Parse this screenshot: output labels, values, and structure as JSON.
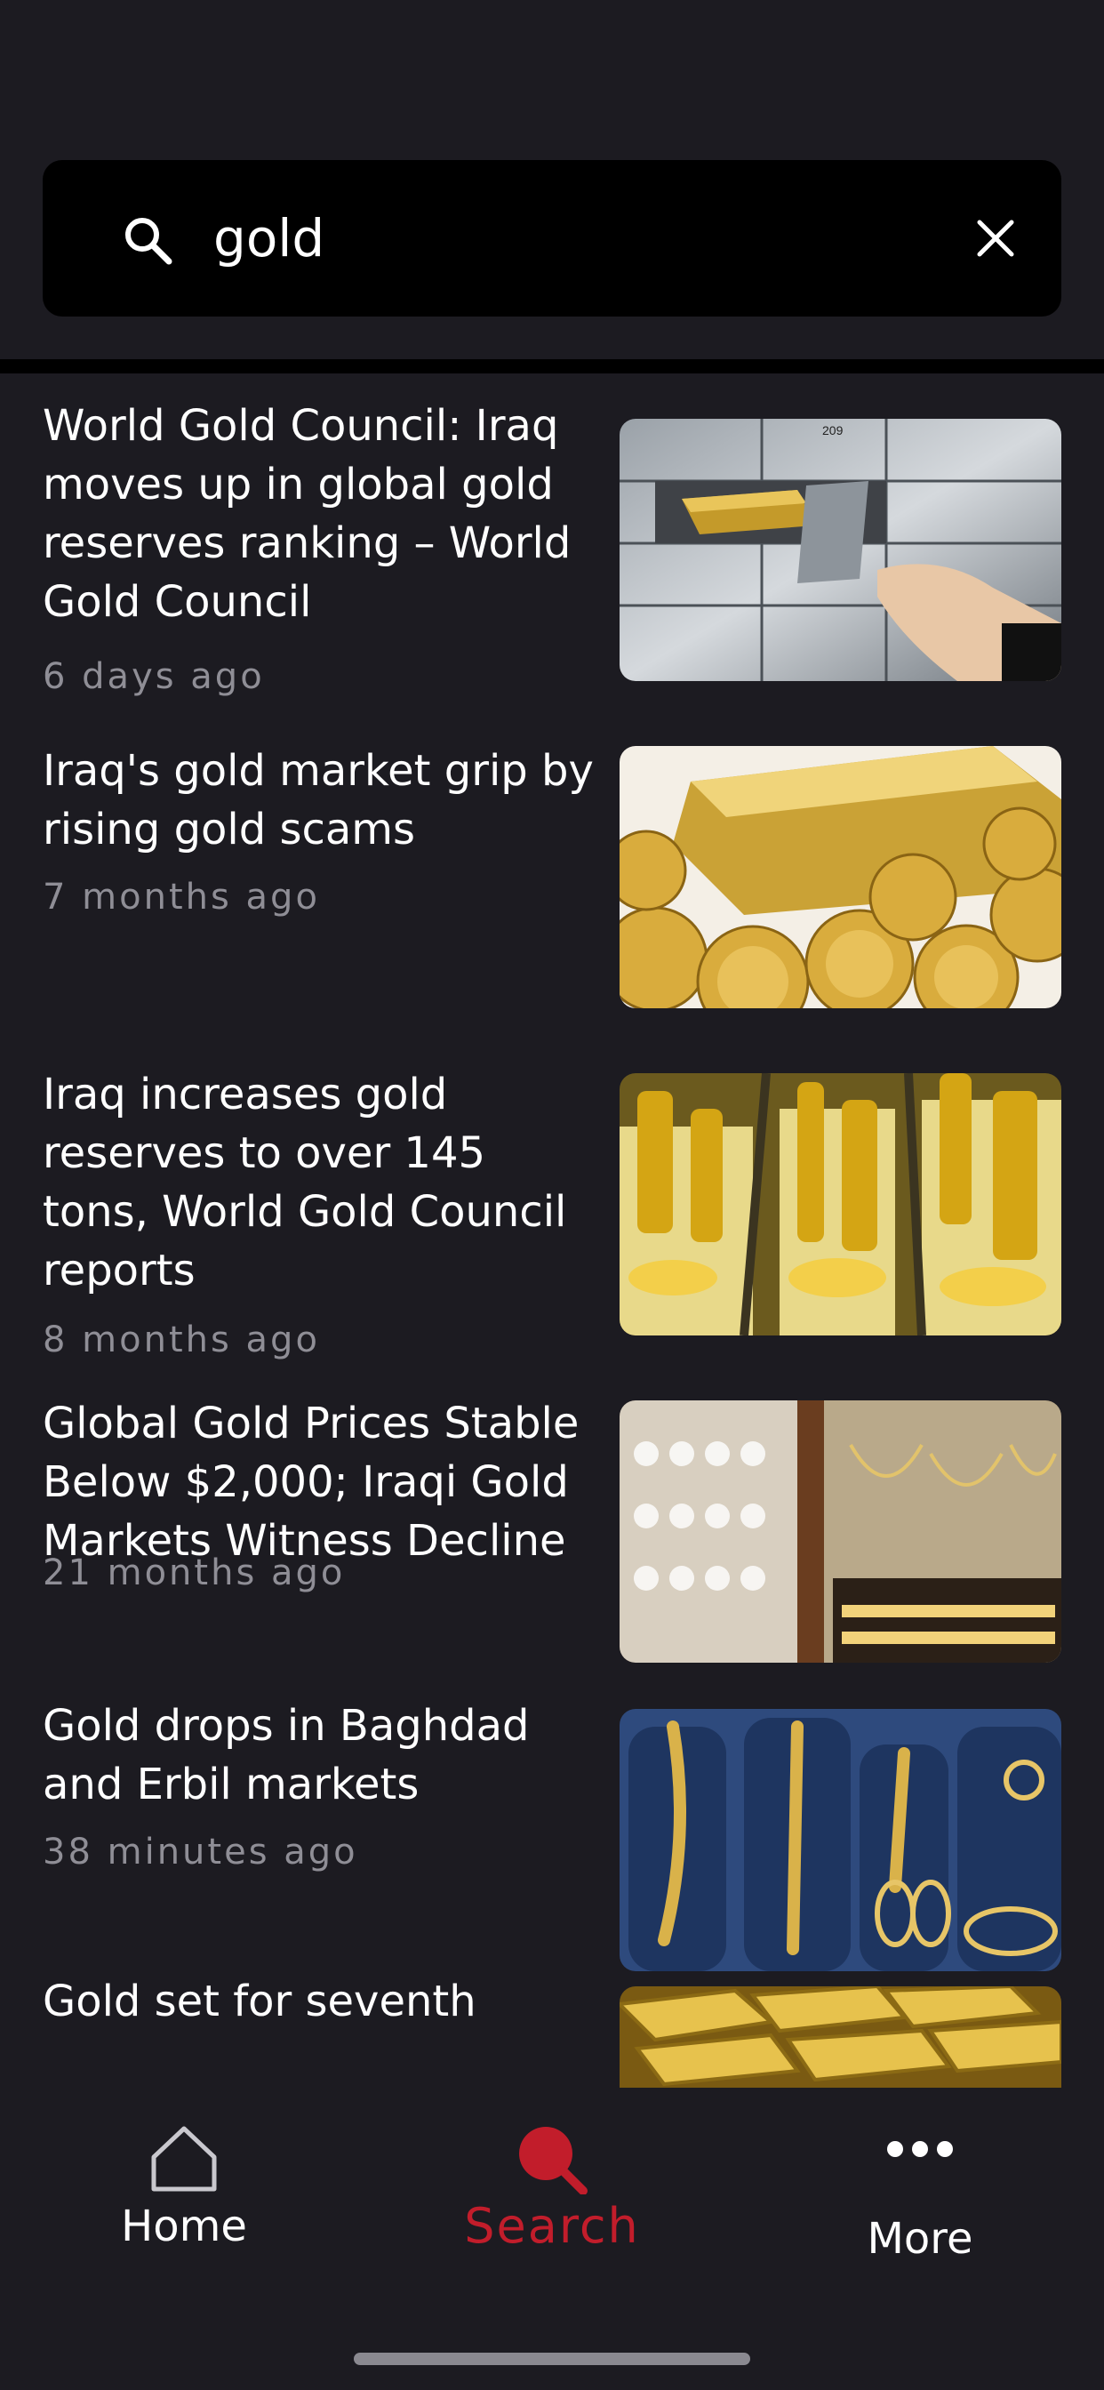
{
  "search": {
    "value": "gold",
    "accent": "#000000"
  },
  "results": [
    {
      "title": "World Gold Council: Iraq moves up in global gold reserves ranking – World Gold Council",
      "time": "6 days ago",
      "thumb_icon": "vault-image"
    },
    {
      "title": "Iraq's gold market grip by rising gold scams",
      "time": "7 months ago",
      "thumb_icon": "gold-bar-coins-image"
    },
    {
      "title": "Iraq increases gold reserves to over 145 tons, World Gold Council reports",
      "time": "8 months ago",
      "thumb_icon": "gold-jewelry-image"
    },
    {
      "title": "Global Gold Prices Stable Below $2,000; Iraqi Gold Markets Witness Decline",
      "time": "21 months ago",
      "thumb_icon": "jewelry-shop-image"
    },
    {
      "title": "Gold drops in Baghdad and Erbil markets",
      "time": "38 minutes ago",
      "thumb_icon": "gold-chains-image"
    },
    {
      "title": "Gold set for seventh",
      "time": "",
      "thumb_icon": "gold-bars-image"
    }
  ],
  "nav": {
    "home_label": "Home",
    "search_label": "Search",
    "more_label": "More",
    "active_color": "#c21d2b"
  }
}
